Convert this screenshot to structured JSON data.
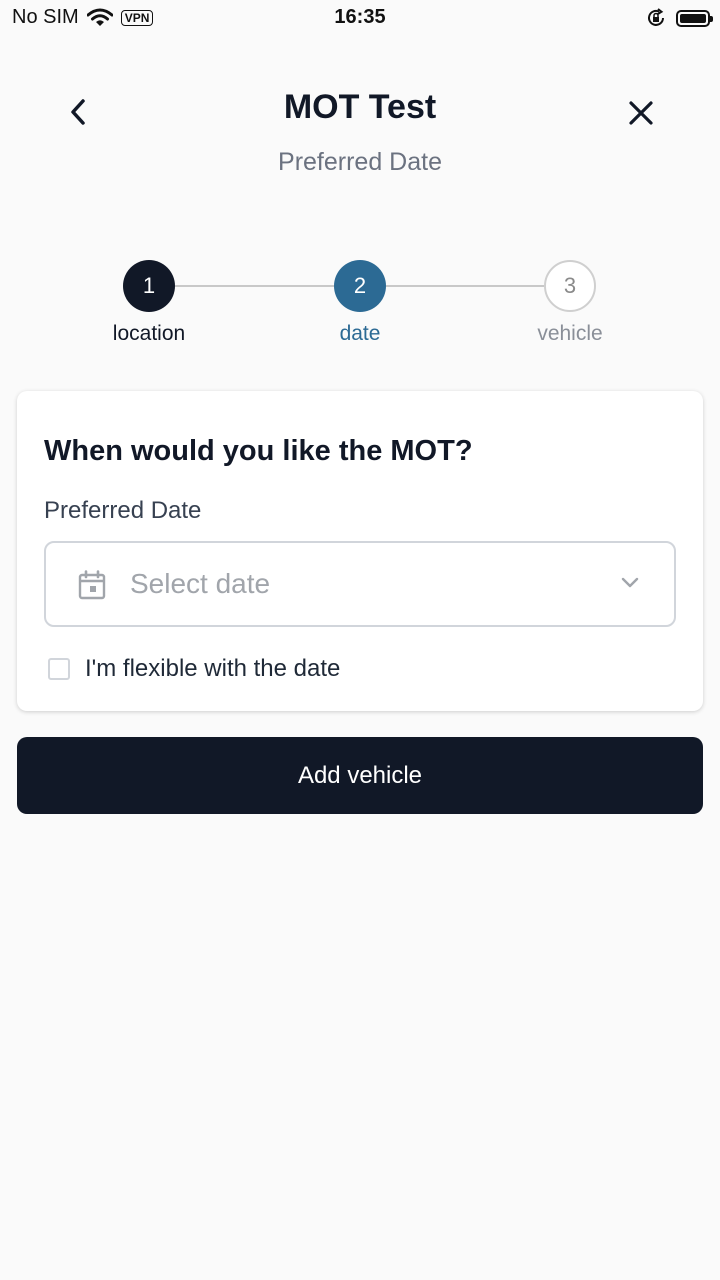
{
  "status_bar": {
    "carrier": "No SIM",
    "vpn": "VPN",
    "time": "16:35",
    "icons": [
      "wifi-icon",
      "orientation-lock-icon",
      "battery-icon"
    ]
  },
  "header": {
    "title": "MOT Test",
    "subtitle": "Preferred Date",
    "back_icon": "chevron-left-icon",
    "close_icon": "close-icon"
  },
  "stepper": {
    "steps": [
      {
        "number": "1",
        "label": "location",
        "state": "completed"
      },
      {
        "number": "2",
        "label": "date",
        "state": "active"
      },
      {
        "number": "3",
        "label": "vehicle",
        "state": "upcoming"
      }
    ]
  },
  "form": {
    "question": "When would you like the MOT?",
    "date_label": "Preferred Date",
    "date_placeholder": "Select date",
    "date_value": "",
    "flexible_label": "I'm flexible with the date",
    "flexible_checked": false
  },
  "actions": {
    "primary_label": "Add vehicle"
  },
  "colors": {
    "background": "#fafafa",
    "primary": "#111827",
    "accent": "#2c6a94",
    "muted": "#6b7280",
    "border": "#d1d5db"
  }
}
